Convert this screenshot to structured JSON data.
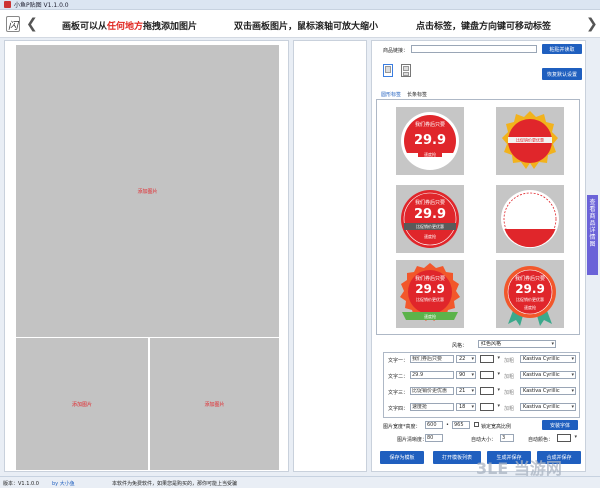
{
  "window": {
    "title": "小鱼P贴图 V1.1.0.0"
  },
  "banner": {
    "logo_glyph": "闪",
    "nav_prev": "❮",
    "nav_next": "❯",
    "hint1_pre": "画板可以从",
    "hint1_red": "任何地方",
    "hint1_post": "拖拽添加图片",
    "hint2": "双击画板图片，鼠标滚轴可放大缩小",
    "hint3": "点击标签，键盘方向键可移动标签"
  },
  "canvas": {
    "placeholders": [
      {
        "label": "添加图片"
      },
      {
        "label": "添加图片"
      },
      {
        "label": "添加图片"
      }
    ]
  },
  "settings": {
    "product_link_label": "商品链接：",
    "product_link_value": "",
    "paste_button": "粘贴并读取",
    "restore_default_button": "恢复默认设置",
    "tabs": [
      "圆形标签",
      "长条标签"
    ],
    "active_tab": 0,
    "badges": [
      {
        "top": "我们券后只要",
        "price": "29.9",
        "sub": "",
        "bottom": "速度抢"
      },
      {
        "top": "",
        "price": "",
        "sub": "比促销价更优惠",
        "bottom": ""
      },
      {
        "top": "我们券后只要",
        "price": "29.9",
        "sub": "比促销价更优惠",
        "bottom": "速度抢"
      },
      {
        "top": "",
        "price": "",
        "sub": "",
        "bottom": ""
      },
      {
        "top": "我们券后只要",
        "price": "29.9",
        "sub": "比促销价更优惠",
        "bottom": "速度抢"
      },
      {
        "top": "我们券后只要",
        "price": "29.9",
        "sub": "比促销价更优惠",
        "bottom": "速度抢"
      }
    ],
    "style_label": "风格：",
    "style_value": "红色风格",
    "text_rows": [
      {
        "label": "文字一：",
        "value": "我们券后只要",
        "size": "22",
        "bold": "加粗",
        "font": "Kastiva Cyrillic"
      },
      {
        "label": "文字二：",
        "value": "29.9",
        "size": "90",
        "bold": "加粗",
        "font": "Kastiva Cyrillic"
      },
      {
        "label": "文字三：",
        "value": "比促销价更优惠",
        "size": "21",
        "bold": "加粗",
        "font": "Kastiva Cyrillic"
      },
      {
        "label": "文字四：",
        "value": "速度抢",
        "size": "18",
        "bold": "加粗",
        "font": "Kastiva Cyrillic"
      }
    ],
    "size_label": "图片宽度*高度：",
    "width_value": "600",
    "height_value": "965",
    "lock_ratio_label": "锁定宽高比例",
    "install_font_button": "安装字体",
    "blur_label": "图片清晰度：",
    "blur_value": "80",
    "auto_size_label": "自动大小：",
    "auto_size_value": "3",
    "auto_color_label": "自动颜色：",
    "save_template_button": "保存为模板",
    "open_template_button": "打开模板列表",
    "generate_button": "生成并保存",
    "preview_button": "合成并保存"
  },
  "sidetab": {
    "label": "查看商品详情图"
  },
  "statusbar": {
    "version": "版本：V1.1.0.0",
    "author": "by 大小鱼",
    "notice": "本软件为免费软件，如果您是购买的，那你可能上当受骗"
  },
  "watermark": "3LE 当游网"
}
